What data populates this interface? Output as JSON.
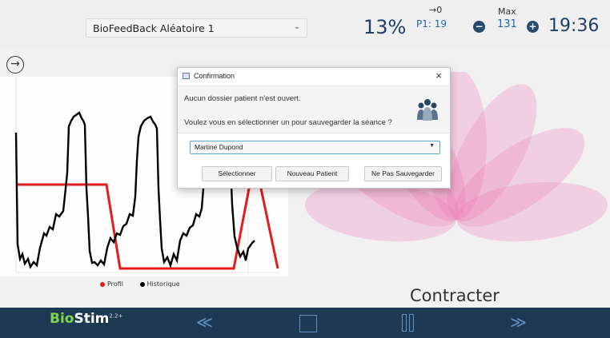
{
  "header": {
    "program_select_value": "BioFeedBack Aléatoire 1",
    "percentage": "13%",
    "arrow_zero_label": "→0",
    "p1_label": "P1: 19",
    "max_label": "Max",
    "max_value": "131",
    "clock": "19:36"
  },
  "chart": {
    "legend": [
      {
        "label": "Profil",
        "color": "#e31c1c"
      },
      {
        "label": "Historique",
        "color": "#000000"
      }
    ]
  },
  "status_text": "Contracter",
  "brand": {
    "bio": "Bio",
    "stim": "Stim",
    "version": "2.2+"
  },
  "controls": {
    "rewind_icon": "rewind-icon",
    "stop_icon": "stop-icon",
    "pause_icon": "pause-icon",
    "forward_icon": "forward-icon"
  },
  "dialog": {
    "title": "Confirmation",
    "message_line1": "Aucun dossier patient n'est ouvert.",
    "message_line2": "Voulez vous en sélectionner un pour sauvegarder la séance ?",
    "patient_select_value": "Martine Dupond",
    "buttons": {
      "select": "Sélectionner",
      "new_patient": "Nouveau Patient",
      "no_save": "Ne Pas Sauvegarder"
    }
  },
  "colors": {
    "accent": "#1e3954",
    "highlight": "#1b64c5",
    "profile_line": "#e31c1c",
    "lotus": "#ec7ab5"
  }
}
